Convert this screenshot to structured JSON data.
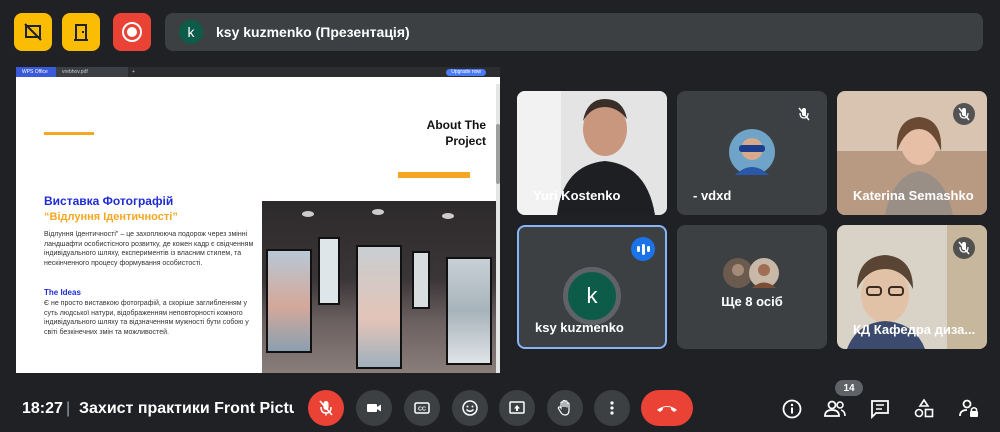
{
  "presentation": {
    "avatar_letter": "k",
    "label": "ksy kuzmenko (Презентація)"
  },
  "shared_screen": {
    "browser_tabs": [
      "WPS Office",
      "vrebhov.pdf"
    ],
    "upgrade_label": "Upgrade now",
    "slide": {
      "heading": "About The Project",
      "title": "Виставка Фотографій",
      "subtitle": "“Відлуння Ідентичності”",
      "body": "Відлуння Ідентичності\" – це захоплююча подорож через змінні ландшафти особистісного розвитку, де кожен кадр є свідченням індивідуального шляху, експериментів із власним стилем, та нескінченного процесу формування особистості.",
      "ideas_heading": "The Ideas",
      "ideas_body": "Є не просто виставкою фотографій, а скоріше заглибленням у суть людської натури, відображенням неповторності кожного індивідуального шляху та відзначенням мужності бути собою у світі безкінечних змін та можливостей."
    }
  },
  "participants": [
    {
      "name": "Yuri Kostenko",
      "muted": false
    },
    {
      "name": "- vdxd",
      "muted": true
    },
    {
      "name": "Katerina Semashko",
      "muted": true
    },
    {
      "name": "ksy kuzmenko",
      "avatar_letter": "k",
      "speaking": true
    },
    {
      "name": "Ще 8 осіб"
    },
    {
      "name": "КД Кафедра диза...",
      "muted": true
    }
  ],
  "bottom_bar": {
    "time": "18:27",
    "separator": "|",
    "meeting_title": "Захист практики Front Pictu...",
    "people_count": "14"
  },
  "colors": {
    "background": "#202124",
    "tile": "#3c4043",
    "yellow": "#fbbc04",
    "red": "#ea4335",
    "blue": "#1a73e8",
    "slide_accent": "#f5a623",
    "slide_title": "#1f2bd6"
  }
}
